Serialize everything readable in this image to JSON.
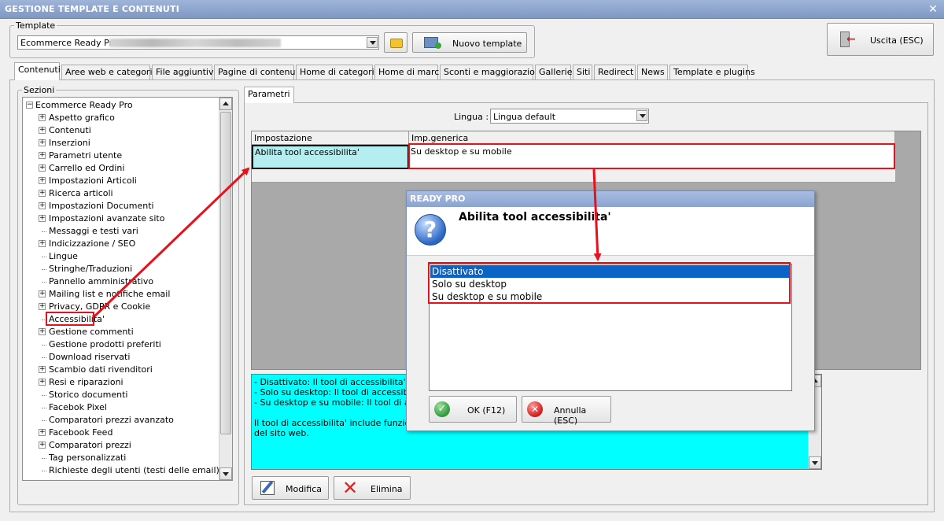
{
  "window": {
    "title": "GESTIONE TEMPLATE E CONTENUTI",
    "close": "✕"
  },
  "template": {
    "group_label": "Template",
    "selected": "Ecommerce Ready Pro",
    "new_button": "Nuovo template"
  },
  "exit_button": "Uscita (ESC)",
  "tabs": [
    "Contenuti",
    "Aree web e categorie",
    "File aggiuntivi",
    "Pagine di contenuti",
    "Home di categoria",
    "Home di marca",
    "Sconti e maggiorazioni",
    "Gallerie",
    "Siti",
    "Redirect",
    "News",
    "Template e plugins"
  ],
  "sections": {
    "group_label": "Sezioni",
    "root": "Ecommerce Ready Pro",
    "items": [
      {
        "label": "Aspetto grafico",
        "expandable": true
      },
      {
        "label": "Contenuti",
        "expandable": true
      },
      {
        "label": "Inserzioni",
        "expandable": true
      },
      {
        "label": "Parametri utente",
        "expandable": true
      },
      {
        "label": "Carrello ed Ordini",
        "expandable": true
      },
      {
        "label": "Impostazioni Articoli",
        "expandable": true
      },
      {
        "label": "Ricerca articoli",
        "expandable": true
      },
      {
        "label": "Impostazioni Documenti",
        "expandable": true
      },
      {
        "label": "Impostazioni avanzate sito",
        "expandable": true
      },
      {
        "label": "Messaggi e testi vari",
        "expandable": false
      },
      {
        "label": "Indicizzazione / SEO",
        "expandable": true
      },
      {
        "label": "Lingue",
        "expandable": false
      },
      {
        "label": "Stringhe/Traduzioni",
        "expandable": false
      },
      {
        "label": "Pannello amministrativo",
        "expandable": false
      },
      {
        "label": "Mailing list e notifiche email",
        "expandable": true
      },
      {
        "label": "Privacy, GDPR e Cookie",
        "expandable": true
      },
      {
        "label": "Accessibilita'",
        "expandable": false
      },
      {
        "label": "Gestione commenti",
        "expandable": true
      },
      {
        "label": "Gestione prodotti preferiti",
        "expandable": false
      },
      {
        "label": "Download riservati",
        "expandable": false
      },
      {
        "label": "Scambio dati rivenditori",
        "expandable": true
      },
      {
        "label": "Resi e riparazioni",
        "expandable": true
      },
      {
        "label": "Storico documenti",
        "expandable": false
      },
      {
        "label": "Facebok Pixel",
        "expandable": false
      },
      {
        "label": "Comparatori prezzi avanzato",
        "expandable": false
      },
      {
        "label": "Facebook Feed",
        "expandable": true
      },
      {
        "label": "Comparatori prezzi",
        "expandable": true
      },
      {
        "label": "Tag personalizzati",
        "expandable": false
      },
      {
        "label": "Richieste degli utenti (testi delle email)",
        "expandable": false
      }
    ]
  },
  "params": {
    "tab": "Parametri",
    "language_label": "Lingua :",
    "language_value": "Lingua default",
    "columns": [
      "Impostazione",
      "Imp.generica"
    ],
    "row": [
      "Abilita tool accessibilita'",
      "Su desktop e su mobile"
    ],
    "description": [
      "- Disattivato: Il tool di accessibilita' riman",
      "- Solo su desktop: Il tool di accessibilita' v",
      "- Su desktop e su mobile: Il tool di access",
      "",
      "Il tool di accessibilita' include funzionalita'",
      "del sito web."
    ],
    "edit_button": "Modifica",
    "delete_button": "Elimina"
  },
  "dialog": {
    "title": "READY PRO",
    "question": "Abilita tool accessibilita'",
    "options": [
      "Disattivato",
      "Solo su desktop",
      "Su desktop e su mobile"
    ],
    "selected_index": 0,
    "ok_button": "OK (F12)",
    "cancel_button": "Annulla (ESC)"
  },
  "colors": {
    "highlight": "#e8101a",
    "selection": "#0a64c8",
    "cyan_cell": "#b4eef0",
    "description_bg": "#00ffff"
  }
}
